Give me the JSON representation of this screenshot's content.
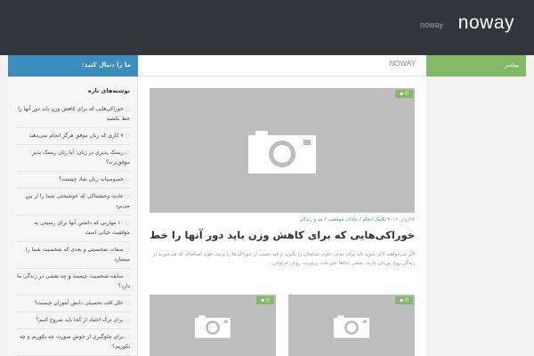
{
  "header": {
    "site_title": "noway",
    "site_description": "noway"
  },
  "tabs": {
    "follow_label": "ما را دنبال کنید:",
    "breadcrumb": "NOWAY",
    "more_label": "بیشتر"
  },
  "colors": {
    "accent_blue": "#3b8dbd",
    "accent_green": "#82b965",
    "topbar": "#33363b"
  },
  "sidebar": {
    "title": "نوشته‌های تازه",
    "items": [
      "خوراکی‌هایی که برای کاهش وزن باید دور آنها را خط بکشید",
      "۷ کاری که زنان موفق هرگز انجام نمی‌دهند",
      "ریسک پذیری در زنان؛ آیا زنان ریسک پذیر موفق‌ترند؟",
      "خصوصیات زنان شاد چیست؟",
      "عادت وحشتناکی که خوشبختی شما را از بین می‌برد",
      "۱۰ مهارتی که داشتن آنها برای رسیدن به موفقیت حیاتی است",
      "صفات شخصیتی و بعدی که شخصیت شما را میسازد",
      "سابقه شخصیت چیست و چه نقشی در زندگی ما دارد؟",
      "علل افت تحصیلی دانش آموزان چیست؟",
      "برای ترک اعتیاد از کجا باید شروع کنیم؟",
      "برای جلوگیری از خوش صورت چه بکوریم و چه نکوریم؟"
    ]
  },
  "featured_post": {
    "comment_count": "0",
    "date": "۲۷ژوئن ۲۰۱۷",
    "categories": "تکنیک انجام / عادات موفقیت / مد و زندگی",
    "title": "خوراکی‌هایی که برای کاهش وزن باید دور آنها را خط بکشید",
    "excerpt": "اگر می‌خواهید لاغر شوید باید برای مدتی جلوی شکمتان را بگیرید و قید بعضی از خوراکی‌ها را بزنید. چون اضافه‌ای که می‌خورید از زندگی روی وزنتان دارند. بعضی غذاها علی‌علت پرچرب، روغن فراوانی..."
  },
  "small_posts": [
    {
      "comment_count": "0"
    },
    {
      "comment_count": "0"
    }
  ]
}
